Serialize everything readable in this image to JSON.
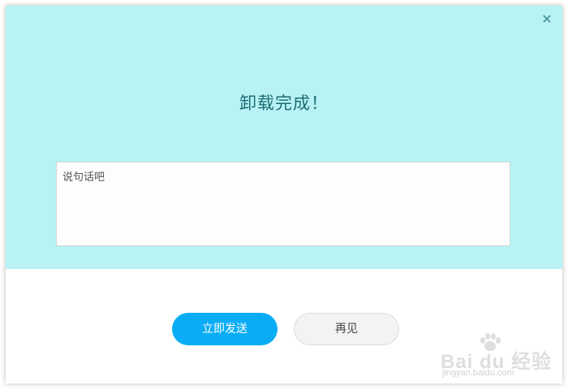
{
  "dialog": {
    "close_glyph": "✕",
    "title": "卸载完成！",
    "comment_placeholder": "说句话吧",
    "send_button_label": "立即发送",
    "bye_button_label": "再见"
  },
  "watermark": {
    "brand": "Bai du 经验",
    "url": "jingyan.baidu.com"
  },
  "colors": {
    "top_background": "#b8f2f4",
    "title": "#1e6d75",
    "send_button": "#0aadf5",
    "bye_button": "#f3f3f3"
  },
  "icons": {
    "close": "close-icon",
    "watermark_logo": "baidu-paw-icon"
  }
}
